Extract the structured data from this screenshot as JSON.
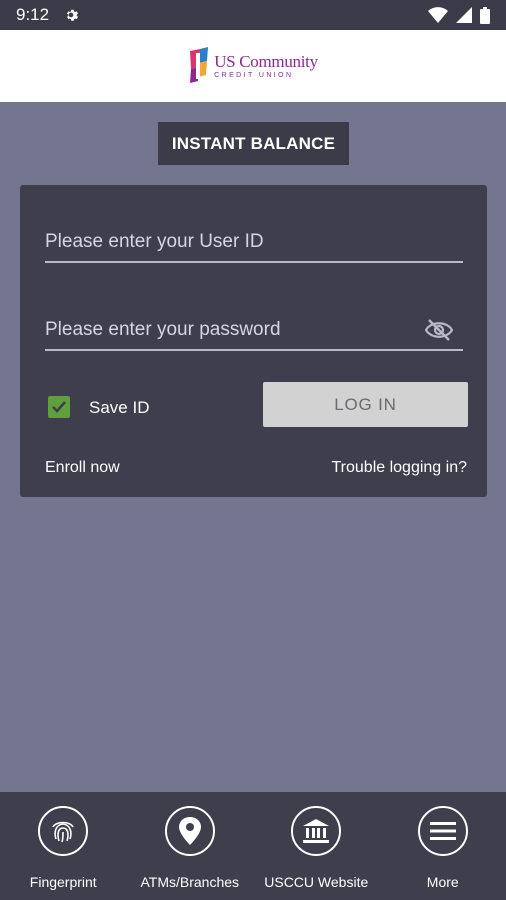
{
  "status_bar": {
    "time": "9:12",
    "icons": [
      "gear-icon",
      "wifi-icon",
      "signal-icon",
      "battery-icon"
    ]
  },
  "header": {
    "logo_main": "US Community",
    "logo_sub": "CREDIT UNION"
  },
  "instant_balance_label": "INSTANT BALANCE",
  "login": {
    "user_placeholder": "Please enter your User ID",
    "password_placeholder": "Please enter your password",
    "save_id_label": "Save ID",
    "save_id_checked": true,
    "login_button": "LOG IN",
    "enroll_link": "Enroll now",
    "trouble_link": "Trouble logging in?"
  },
  "bottom_nav": {
    "items": [
      {
        "label": "Fingerprint",
        "icon": "fingerprint-icon"
      },
      {
        "label": "ATMs/Branches",
        "icon": "location-pin-icon"
      },
      {
        "label": "USCCU Website",
        "icon": "bank-icon"
      },
      {
        "label": "More",
        "icon": "menu-icon"
      }
    ]
  },
  "colors": {
    "background": "#74768f",
    "dark_panel": "#3e3e4d",
    "checkbox_green": "#5f9f3c",
    "brand_purple": "#8a2a8f"
  }
}
